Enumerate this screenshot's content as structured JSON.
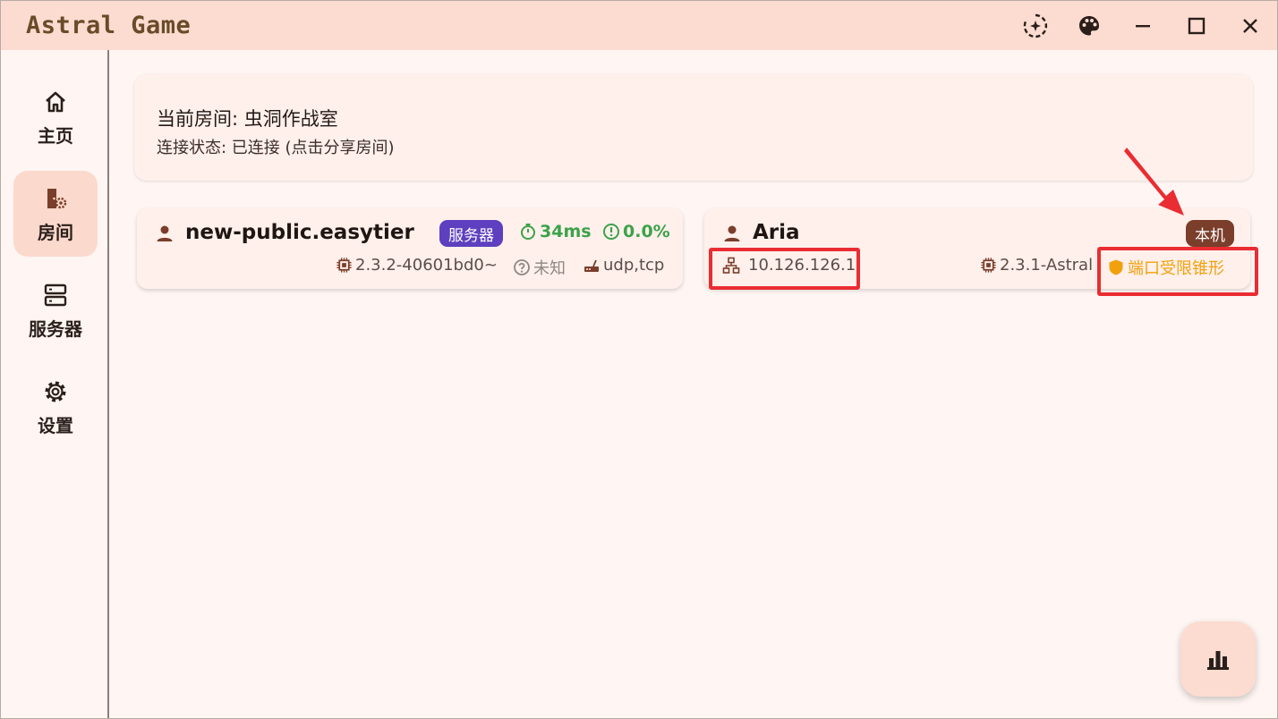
{
  "app": {
    "title": "Astral Game"
  },
  "titlebar": {
    "icons": [
      "sparkle-sync-icon",
      "palette-icon",
      "minimize-icon",
      "maximize-icon",
      "close-icon"
    ]
  },
  "sidebar": {
    "items": [
      {
        "label": "主页",
        "icon": "home-icon",
        "active": false
      },
      {
        "label": "房间",
        "icon": "room-settings-icon",
        "active": true
      },
      {
        "label": "服务器",
        "icon": "server-icon",
        "active": false
      },
      {
        "label": "设置",
        "icon": "gear-icon",
        "active": false
      }
    ]
  },
  "room": {
    "title": "当前房间: 虫洞作战室",
    "status": "连接状态: 已连接 (点击分享房间)"
  },
  "peers": [
    {
      "name": "new-public.easytier",
      "badge": "服务器",
      "latency": "34ms",
      "loss": "0.0%",
      "version": "2.3.2-40601bd0~",
      "nat": "未知",
      "protocols": "udp,tcp"
    },
    {
      "name": "Aria",
      "badge": "本机",
      "ip": "10.126.126.1",
      "version": "2.3.1-Astral",
      "nat": "端口受限锥形"
    }
  ],
  "colors": {
    "titlebar_bg": "#fcdcd0",
    "accent_brown": "#7a3e2a",
    "server_badge": "#5e3fbf",
    "good_green": "#3ca24a",
    "nat_orange": "#f2a10e",
    "highlight_red": "#ea2c33"
  },
  "fab": {
    "icon": "bar-chart-icon"
  }
}
